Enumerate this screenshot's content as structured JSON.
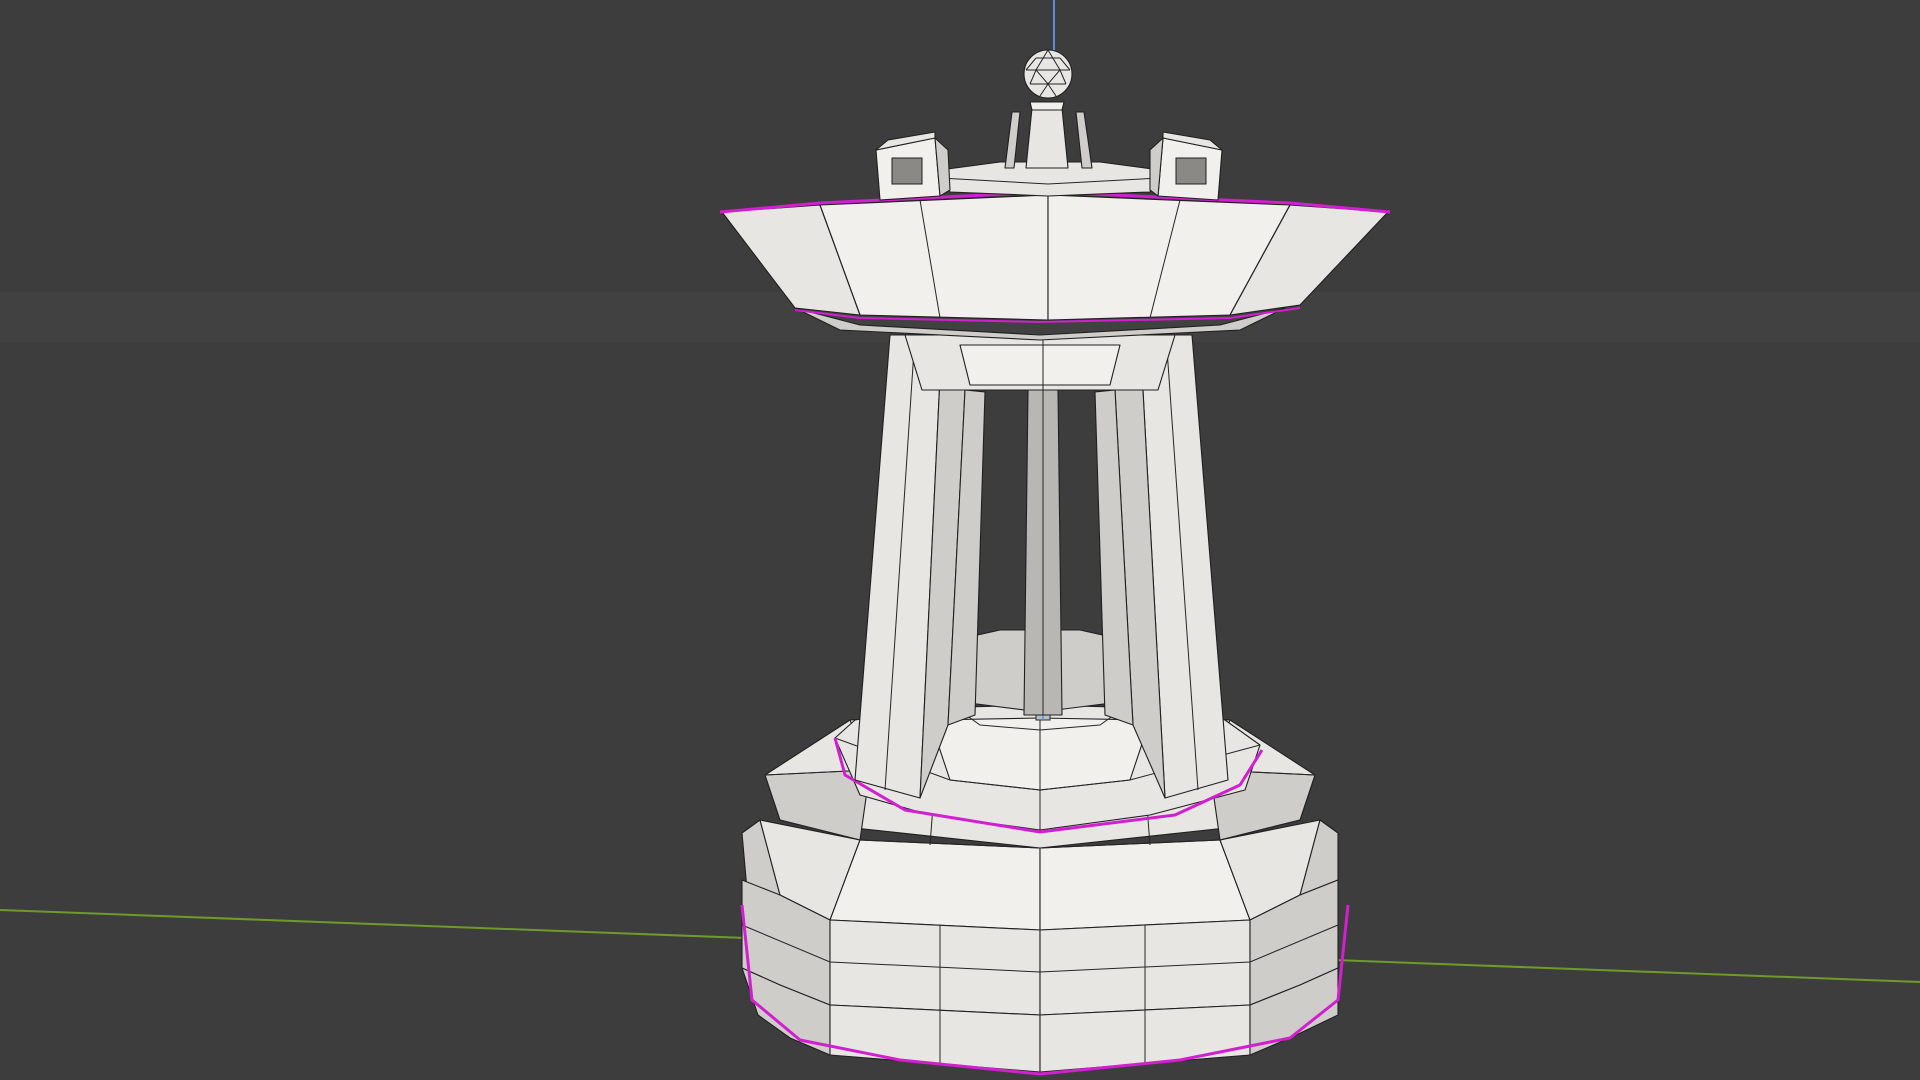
{
  "viewport": {
    "background": "#3d3d3d",
    "x_axis_color": "#6f9a2a",
    "z_axis_color": "#5a8fd8",
    "mesh_color": "#e7e6e3",
    "selection_color": "#d21fd0"
  },
  "scene": {
    "object": "tower-mesh",
    "mode": "edit-mode-wireframe-overlay"
  }
}
